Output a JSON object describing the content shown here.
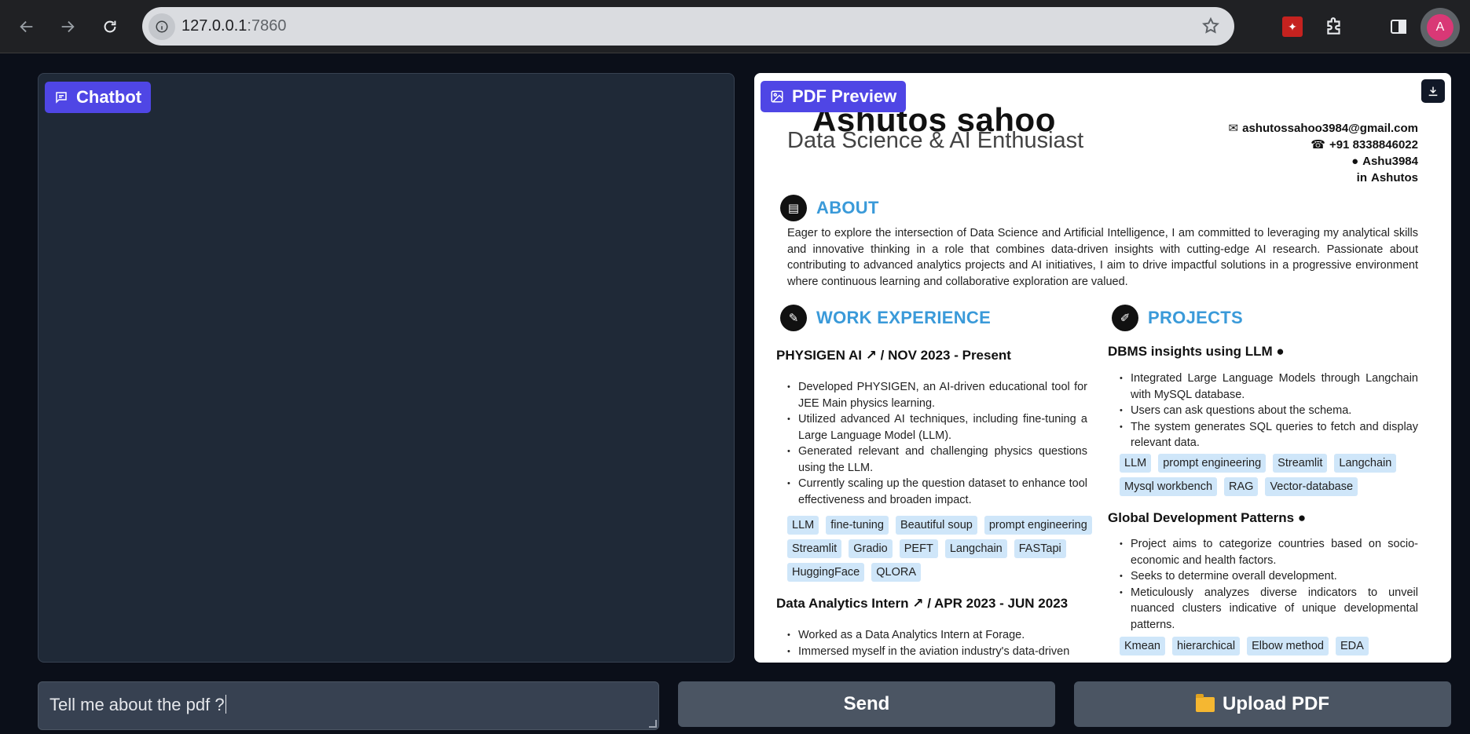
{
  "browser": {
    "url_host": "127.0.0.1",
    "url_port": ":7860",
    "avatar_initial": "A"
  },
  "chatbot": {
    "label": "Chatbot"
  },
  "pdf_preview": {
    "label": "PDF Preview",
    "resume": {
      "name": "Ashutos sahoo",
      "role": "Data Science & AI Enthusiast",
      "contact": {
        "email": "ashutossahoo3984@gmail.com",
        "phone": "+91 8338846022",
        "github": "Ashu3984",
        "linkedin": "Ashutos"
      },
      "about": {
        "title": "ABOUT",
        "text": "Eager to explore the intersection of Data Science and Artificial Intelligence, I am committed to leveraging my analytical skills and innovative thinking in a role that combines data-driven insights with cutting-edge AI research.  Passionate about contributing to advanced analytics projects and AI initiatives, I aim to drive impactful solutions in a progressive environment where continuous learning and collaborative exploration are valued."
      },
      "work": {
        "title": "WORK EXPERIENCE",
        "jobs": [
          {
            "title": "PHYSIGEN AI",
            "period": "/ NOV 2023 - Present",
            "bullets": [
              "Developed PHYSIGEN, an AI-driven educational tool for JEE Main physics learning.",
              "Utilized advanced AI techniques, including fine-tuning a Large Language Model (LLM).",
              "Generated relevant and challenging physics questions using the LLM.",
              "Currently scaling up the question dataset to enhance tool effectiveness and broaden impact."
            ],
            "tags": [
              "LLM",
              "fine-tuning",
              "Beautiful soup",
              "prompt engineering",
              "Streamlit",
              "Gradio",
              "PEFT",
              "Langchain",
              "FASTapi",
              "HuggingFace",
              "QLORA"
            ]
          },
          {
            "title": "Data Analytics Intern",
            "period": "/ APR 2023 - JUN 2023",
            "bullets": [
              "Worked as a Data Analytics Intern at Forage.",
              "Immersed myself in the aviation industry's data-driven"
            ]
          }
        ]
      },
      "projects": {
        "title": "PROJECTS",
        "items": [
          {
            "title": "DBMS insights using LLM",
            "bullets": [
              "Integrated Large Language Models through Langchain with MySQL database.",
              "Users can ask questions about the schema.",
              "The system generates SQL queries to fetch and display relevant data."
            ],
            "tags": [
              "LLM",
              "prompt engineering",
              "Streamlit",
              "Langchain",
              "Mysql workbench",
              "RAG",
              "Vector-database"
            ]
          },
          {
            "title": "Global Development Patterns",
            "bullets": [
              "Project aims to categorize countries based on socio-economic and health factors.",
              "Seeks to determine overall development.",
              "Meticulously analyzes diverse indicators to unveil nuanced clusters indicative of unique developmental patterns."
            ],
            "tags": [
              "Kmean",
              "hierarchical",
              "Elbow method",
              "EDA"
            ]
          }
        ]
      }
    }
  },
  "input": {
    "value": "Tell me about the pdf ?"
  },
  "buttons": {
    "send": "Send",
    "upload": "Upload PDF"
  }
}
